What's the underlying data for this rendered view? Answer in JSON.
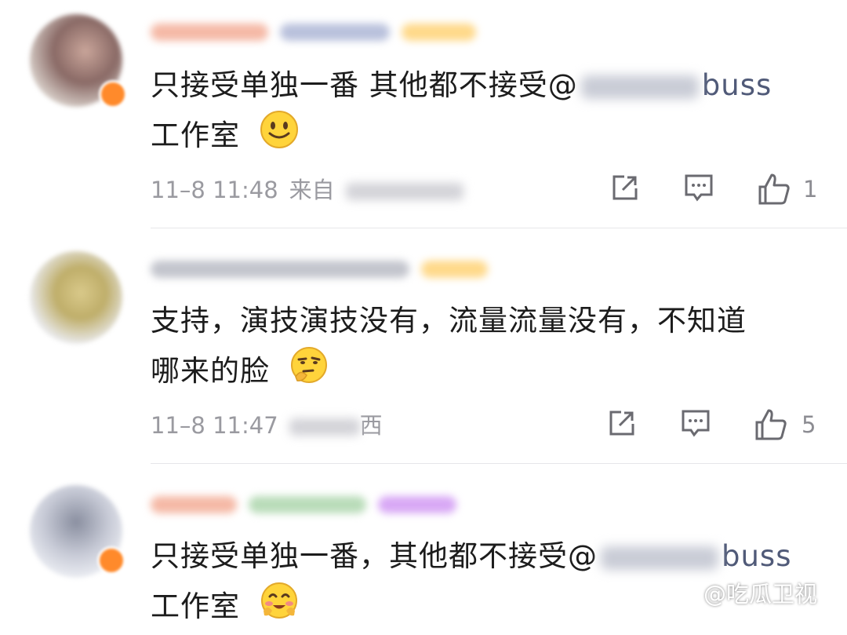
{
  "comments": [
    {
      "text_main": "只接受单独一番 其他都不接受@",
      "mention_suffix": "buss",
      "text_line2": "工作室",
      "emoji": "smile-emoji",
      "time": "11–8 11:48",
      "location_prefix": "来自",
      "likes": "1"
    },
    {
      "text_line1": "支持，演技演技没有，流量流量没有，不知道",
      "text_line2": "哪来的脸",
      "emoji": "thinking-face-emoji",
      "time": "11–8 11:47",
      "location_suffix": "西",
      "likes": "5"
    },
    {
      "text_main": "只接受单独一番，其他都不接受@",
      "mention_suffix": "buss",
      "text_line2": "工作室",
      "emoji": "blush-emoji"
    }
  ],
  "watermark": {
    "icon": "weibo-logo-icon",
    "text": "@吃瓜卫视"
  },
  "colors": {
    "accent_orange": "#ff8a2b",
    "meta_gray": "#9a9aa0",
    "mention_blue": "#505a78"
  }
}
